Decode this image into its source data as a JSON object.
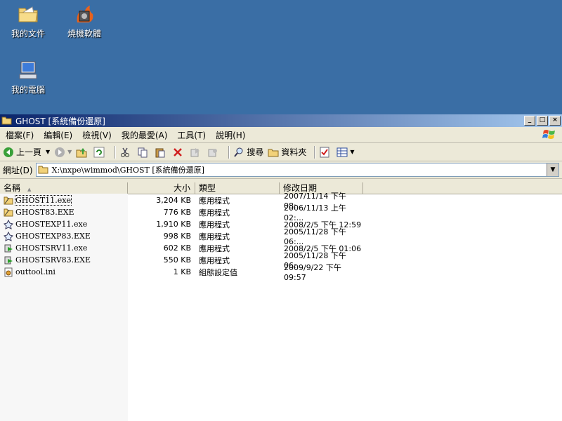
{
  "desktop": {
    "icons": [
      {
        "label": "我的文件"
      },
      {
        "label": "燒機軟體"
      },
      {
        "label": "我的電腦"
      }
    ]
  },
  "window": {
    "title": "GHOST [系統備份還原]",
    "controls": {
      "minimize": "_",
      "maximize": "□",
      "close": "×"
    }
  },
  "menubar": {
    "items": [
      "檔案(F)",
      "編輯(E)",
      "檢視(V)",
      "我的最愛(A)",
      "工具(T)",
      "說明(H)"
    ]
  },
  "toolbar": {
    "back_label": "上一頁",
    "search_label": "搜尋",
    "folders_label": "資料夾"
  },
  "address": {
    "label": "網址(D)",
    "value": "X:\\nxpe\\wimmod\\GHOST [系統備份還原]"
  },
  "columns": {
    "name": "名稱",
    "size": "大小",
    "type": "類型",
    "date": "修改日期"
  },
  "files": [
    {
      "name": "GHOST11.exe",
      "size": "3,204 KB",
      "type": "應用程式",
      "date": "2007/11/14 下午 08:...",
      "icon": "ghost-exe-icon"
    },
    {
      "name": "GHOST83.EXE",
      "size": "776 KB",
      "type": "應用程式",
      "date": "2006/11/13 上午 02:...",
      "icon": "ghost-exe-icon"
    },
    {
      "name": "GHOSTEXP11.exe",
      "size": "1,910 KB",
      "type": "應用程式",
      "date": "2008/2/5 下午 12:59",
      "icon": "ghost-explorer-icon"
    },
    {
      "name": "GHOSTEXP83.EXE",
      "size": "998 KB",
      "type": "應用程式",
      "date": "2005/11/28 下午 06:...",
      "icon": "ghost-explorer-icon"
    },
    {
      "name": "GHOSTSRV11.exe",
      "size": "602 KB",
      "type": "應用程式",
      "date": "2008/2/5 下午 01:06",
      "icon": "ghost-server-icon"
    },
    {
      "name": "GHOSTSRV83.EXE",
      "size": "550 KB",
      "type": "應用程式",
      "date": "2005/11/28 下午 06:...",
      "icon": "ghost-server-icon"
    },
    {
      "name": "outtool.ini",
      "size": "1 KB",
      "type": "組態設定值",
      "date": "2009/9/22 下午 09:57",
      "icon": "ini-file-icon"
    }
  ],
  "colors": {
    "desktop": "#3a6ea5",
    "titlebar_start": "#0a246a",
    "titlebar_end": "#a6caf0"
  }
}
